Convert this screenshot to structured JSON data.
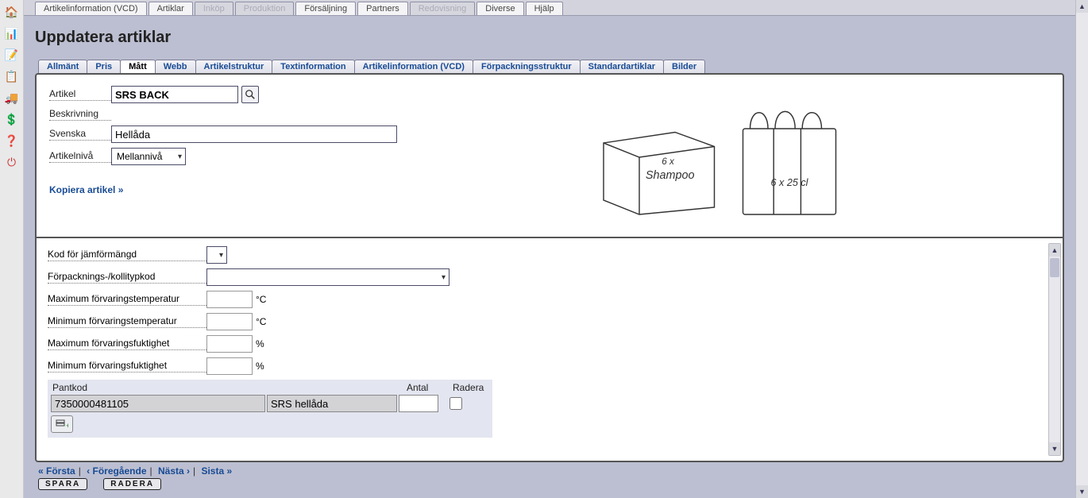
{
  "top_tabs": [
    {
      "label": "Artikelinformation (VCD)",
      "state": "normal"
    },
    {
      "label": "Artiklar",
      "state": "normal"
    },
    {
      "label": "Inköp",
      "state": "disabled"
    },
    {
      "label": "Produktion",
      "state": "disabled"
    },
    {
      "label": "Försäljning",
      "state": "normal"
    },
    {
      "label": "Partners",
      "state": "normal"
    },
    {
      "label": "Redovisning",
      "state": "disabled"
    },
    {
      "label": "Diverse",
      "state": "normal"
    },
    {
      "label": "Hjälp",
      "state": "normal"
    }
  ],
  "page_title": "Uppdatera artiklar",
  "inner_tabs": [
    "Allmänt",
    "Pris",
    "Mått",
    "Webb",
    "Artikelstruktur",
    "Textinformation",
    "Artikelinformation (VCD)",
    "Förpackningsstruktur",
    "Standardartiklar",
    "Bilder"
  ],
  "inner_active": "Mått",
  "form": {
    "artikel_label": "Artikel",
    "artikel_value": "SRS BACK",
    "beskrivning_label": "Beskrivning",
    "svenska_label": "Svenska",
    "svenska_value": "Hellåda",
    "artikelniva_label": "Artikelnivå",
    "artikelniva_value": "Mellannivå",
    "copy_link": "Kopiera artikel »"
  },
  "illustration": {
    "box_text_top": "6 x",
    "box_text_main": "Shampoo",
    "carrier_text": "6 x 25 cl"
  },
  "props": {
    "kod_label": "Kod för jämförmängd",
    "kod_value": "",
    "forpack_label": "Förpacknings-/kollitypkod",
    "forpack_value": "",
    "max_temp_label": "Maximum förvaringstemperatur",
    "max_temp_value": "",
    "max_temp_unit": "°C",
    "min_temp_label": "Minimum förvaringstemperatur",
    "min_temp_value": "",
    "min_temp_unit": "°C",
    "max_hum_label": "Maximum förvaringsfuktighet",
    "max_hum_value": "",
    "max_hum_unit": "%",
    "min_hum_label": "Minimum förvaringsfuktighet",
    "min_hum_value": "",
    "min_hum_unit": "%"
  },
  "pantkod": {
    "col_pant": "Pantkod",
    "col_antal": "Antal",
    "col_radera": "Radera",
    "row": {
      "code": "7350000481105",
      "desc": "SRS hellåda",
      "antal": ""
    }
  },
  "pager": {
    "first": "« Första",
    "prev": "‹ Föregående",
    "next": "Nästa ›",
    "last": "Sista »"
  },
  "buttons": {
    "save": "SPARA",
    "delete": "RADERA"
  }
}
